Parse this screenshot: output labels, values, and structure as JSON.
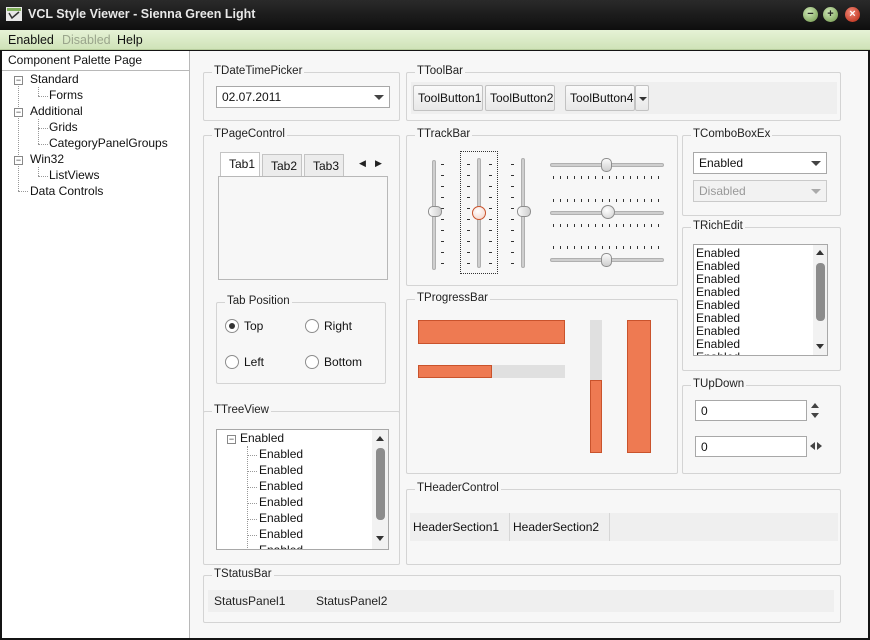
{
  "window": {
    "title": "VCL Style Viewer - Sienna Green Light",
    "icon": "app-icon",
    "controls": {
      "minimize": "−",
      "maximize": "+",
      "close": "×"
    }
  },
  "colors": {
    "accent": "#ee7a52",
    "menubar": "#d8ebc4",
    "title_bg": "#141414"
  },
  "menu": {
    "items": [
      "Enabled",
      "Disabled",
      "Help"
    ]
  },
  "component_palette": {
    "header": "Component Palette Page",
    "tree": [
      {
        "label": "Standard",
        "children": [
          "Forms"
        ]
      },
      {
        "label": "Additional",
        "children": [
          "Grids",
          "CategoryPanelGroups"
        ]
      },
      {
        "label": "Win32",
        "children": [
          "ListViews"
        ]
      },
      {
        "label": "Data Controls",
        "children": []
      }
    ]
  },
  "datetimepicker": {
    "title": "TDateTimePicker",
    "value": "02.07.2011"
  },
  "toolbar": {
    "title": "TToolBar",
    "buttons": [
      "ToolButton1",
      "ToolButton2",
      "ToolButton4"
    ]
  },
  "pagecontrol": {
    "title": "TPageControl",
    "tabs": [
      "Tab1",
      "Tab2",
      "Tab3"
    ],
    "arrows": {
      "left": "◀",
      "right": "▶"
    }
  },
  "tab_position": {
    "title": "Tab Position",
    "options": [
      "Top",
      "Right",
      "Left",
      "Bottom"
    ],
    "selected": "Top"
  },
  "trackbar": {
    "title": "TTrackBar"
  },
  "progressbar": {
    "title": "TProgressBar",
    "values": [
      1.0,
      0.5,
      0.55,
      1.0
    ]
  },
  "comboboxex": {
    "title": "TComboBoxEx",
    "enabled_value": "Enabled",
    "disabled_value": "Disabled"
  },
  "richedit": {
    "title": "TRichEdit",
    "lines": [
      "Enabled",
      "Enabled",
      "Enabled",
      "Enabled",
      "Enabled",
      "Enabled",
      "Enabled",
      "Enabled",
      "Enabled"
    ]
  },
  "treeview": {
    "title": "TTreeView",
    "root": "Enabled",
    "children": [
      "Enabled",
      "Enabled",
      "Enabled",
      "Enabled",
      "Enabled",
      "Enabled",
      "Enabled"
    ]
  },
  "updown": {
    "title": "TUpDown",
    "value1": "0",
    "value2": "0"
  },
  "headercontrol": {
    "title": "THeaderControl",
    "sections": [
      "HeaderSection1",
      "HeaderSection2"
    ]
  },
  "statusbar": {
    "title": "TStatusBar",
    "panels": [
      "StatusPanel1",
      "StatusPanel2"
    ]
  }
}
